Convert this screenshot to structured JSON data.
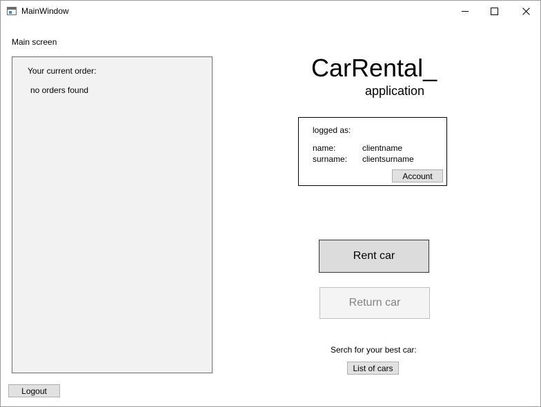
{
  "window": {
    "title": "MainWindow",
    "icon": "app-window-icon"
  },
  "caption_buttons": {
    "minimize_icon": "minimize-icon",
    "maximize_icon": "maximize-icon",
    "close_icon": "close-icon"
  },
  "main": {
    "screen_label": "Main screen"
  },
  "order_panel": {
    "heading": "Your current order:",
    "empty_text": "no orders found"
  },
  "branding": {
    "title": "CarRental_",
    "subtitle": "application"
  },
  "login_info": {
    "heading": "logged as:",
    "name_label": "name:",
    "name_value": "clientname",
    "surname_label": "surname:",
    "surname_value": "clientsurname",
    "account_button_label": "Account"
  },
  "actions": {
    "rent_car_label": "Rent car",
    "return_car_label": "Return car",
    "return_car_enabled": false
  },
  "search": {
    "prompt": "Serch for your best car:",
    "list_button_label": "List of cars"
  },
  "footer": {
    "logout_label": "Logout"
  },
  "colors": {
    "panel_background": "#f2f2f2",
    "button_background": "#e1e1e1",
    "disabled_text": "#838383"
  }
}
